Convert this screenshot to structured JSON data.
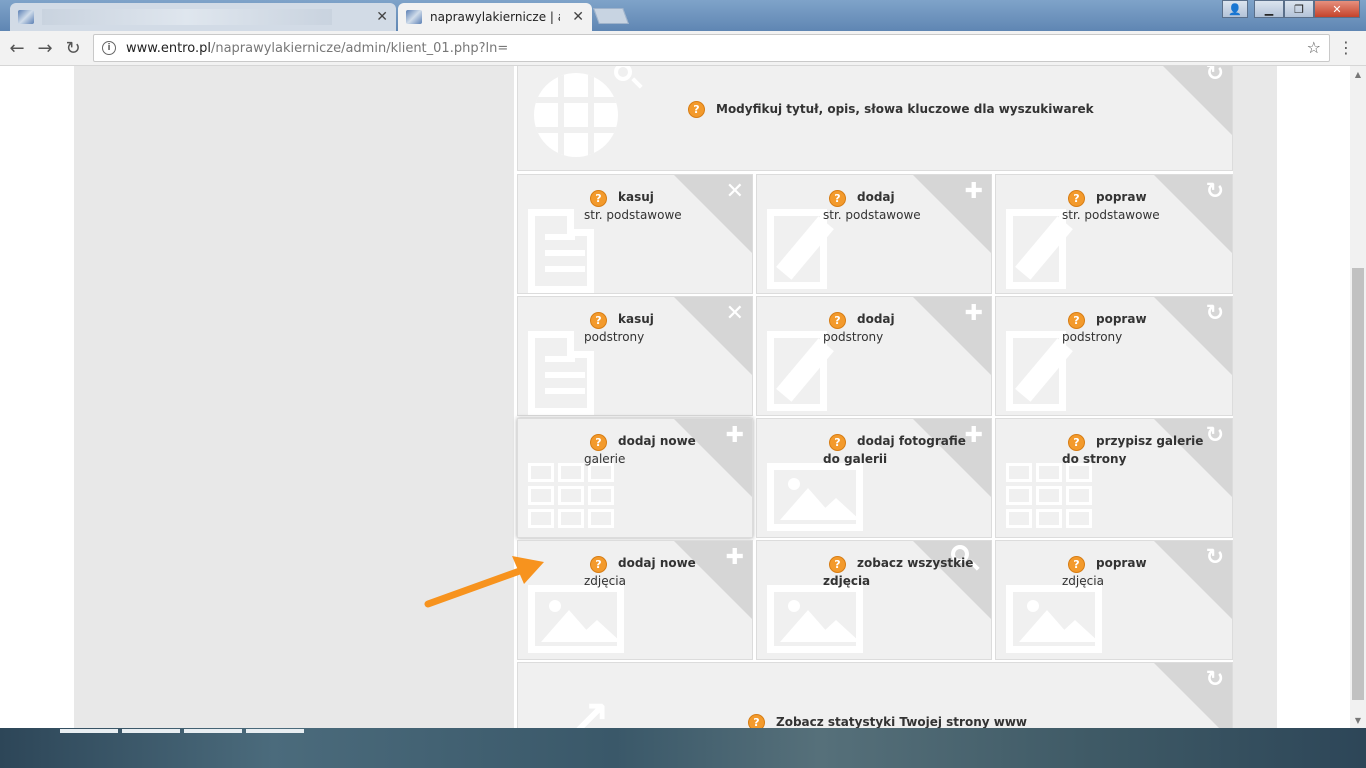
{
  "browser": {
    "tabs": [
      {
        "title": "",
        "close": "✕"
      },
      {
        "title": "naprawylakiernicze | admi",
        "close": "✕"
      }
    ],
    "window_controls": {
      "user": "👤",
      "minimize": "▁",
      "maximize": "❐",
      "close": "✕"
    },
    "nav": {
      "back": "←",
      "forward": "→",
      "reload": "↻"
    },
    "url_host": "www.entro.pl",
    "url_path": "/naprawylakiernicze/admin/klient_01.php?ln=",
    "star": "☆",
    "menu": "⋮"
  },
  "tiles": {
    "seo": {
      "title": "Modyfikuj tytuł, opis, słowa kluczowe dla wyszukiwarek",
      "help": "?",
      "corner": "↻"
    },
    "row1": [
      {
        "title": "kasuj",
        "sub": "str. podstawowe",
        "help": "?",
        "corner": "✕"
      },
      {
        "title": "dodaj",
        "sub": "str. podstawowe",
        "help": "?",
        "corner": "✚"
      },
      {
        "title": "popraw",
        "sub": "str. podstawowe",
        "help": "?",
        "corner": "↻"
      }
    ],
    "row2": [
      {
        "title": "kasuj",
        "sub": "podstrony",
        "help": "?",
        "corner": "✕"
      },
      {
        "title": "dodaj",
        "sub": "podstrony",
        "help": "?",
        "corner": "✚"
      },
      {
        "title": "popraw",
        "sub": "podstrony",
        "help": "?",
        "corner": "↻"
      }
    ],
    "row3": [
      {
        "title": "dodaj nowe",
        "sub": "galerie",
        "help": "?",
        "corner": "✚"
      },
      {
        "title": "dodaj fotografie",
        "sub": "do galerii",
        "help": "?",
        "corner": "✚"
      },
      {
        "title": "przypisz galerie",
        "sub": "do strony",
        "help": "?",
        "corner": "↻"
      }
    ],
    "row4": [
      {
        "title": "dodaj nowe",
        "sub": "zdjęcia",
        "help": "?",
        "corner": "✚"
      },
      {
        "title": "zobacz wszystkie",
        "sub": "zdjęcia",
        "help": "?",
        "corner": "⚲"
      },
      {
        "title": "popraw",
        "sub": "zdjęcia",
        "help": "?",
        "corner": "↻"
      }
    ],
    "stats": {
      "title": "Zobacz statystyki Twojej strony www",
      "help": "?",
      "corner": "↻"
    }
  },
  "scrollbar": {
    "up": "▲",
    "down": "▼"
  },
  "colors": {
    "accent": "#f39a2c",
    "tile_bg": "#f0f0f0",
    "corner": "#d6d6d6",
    "arrow": "#f7931e"
  }
}
